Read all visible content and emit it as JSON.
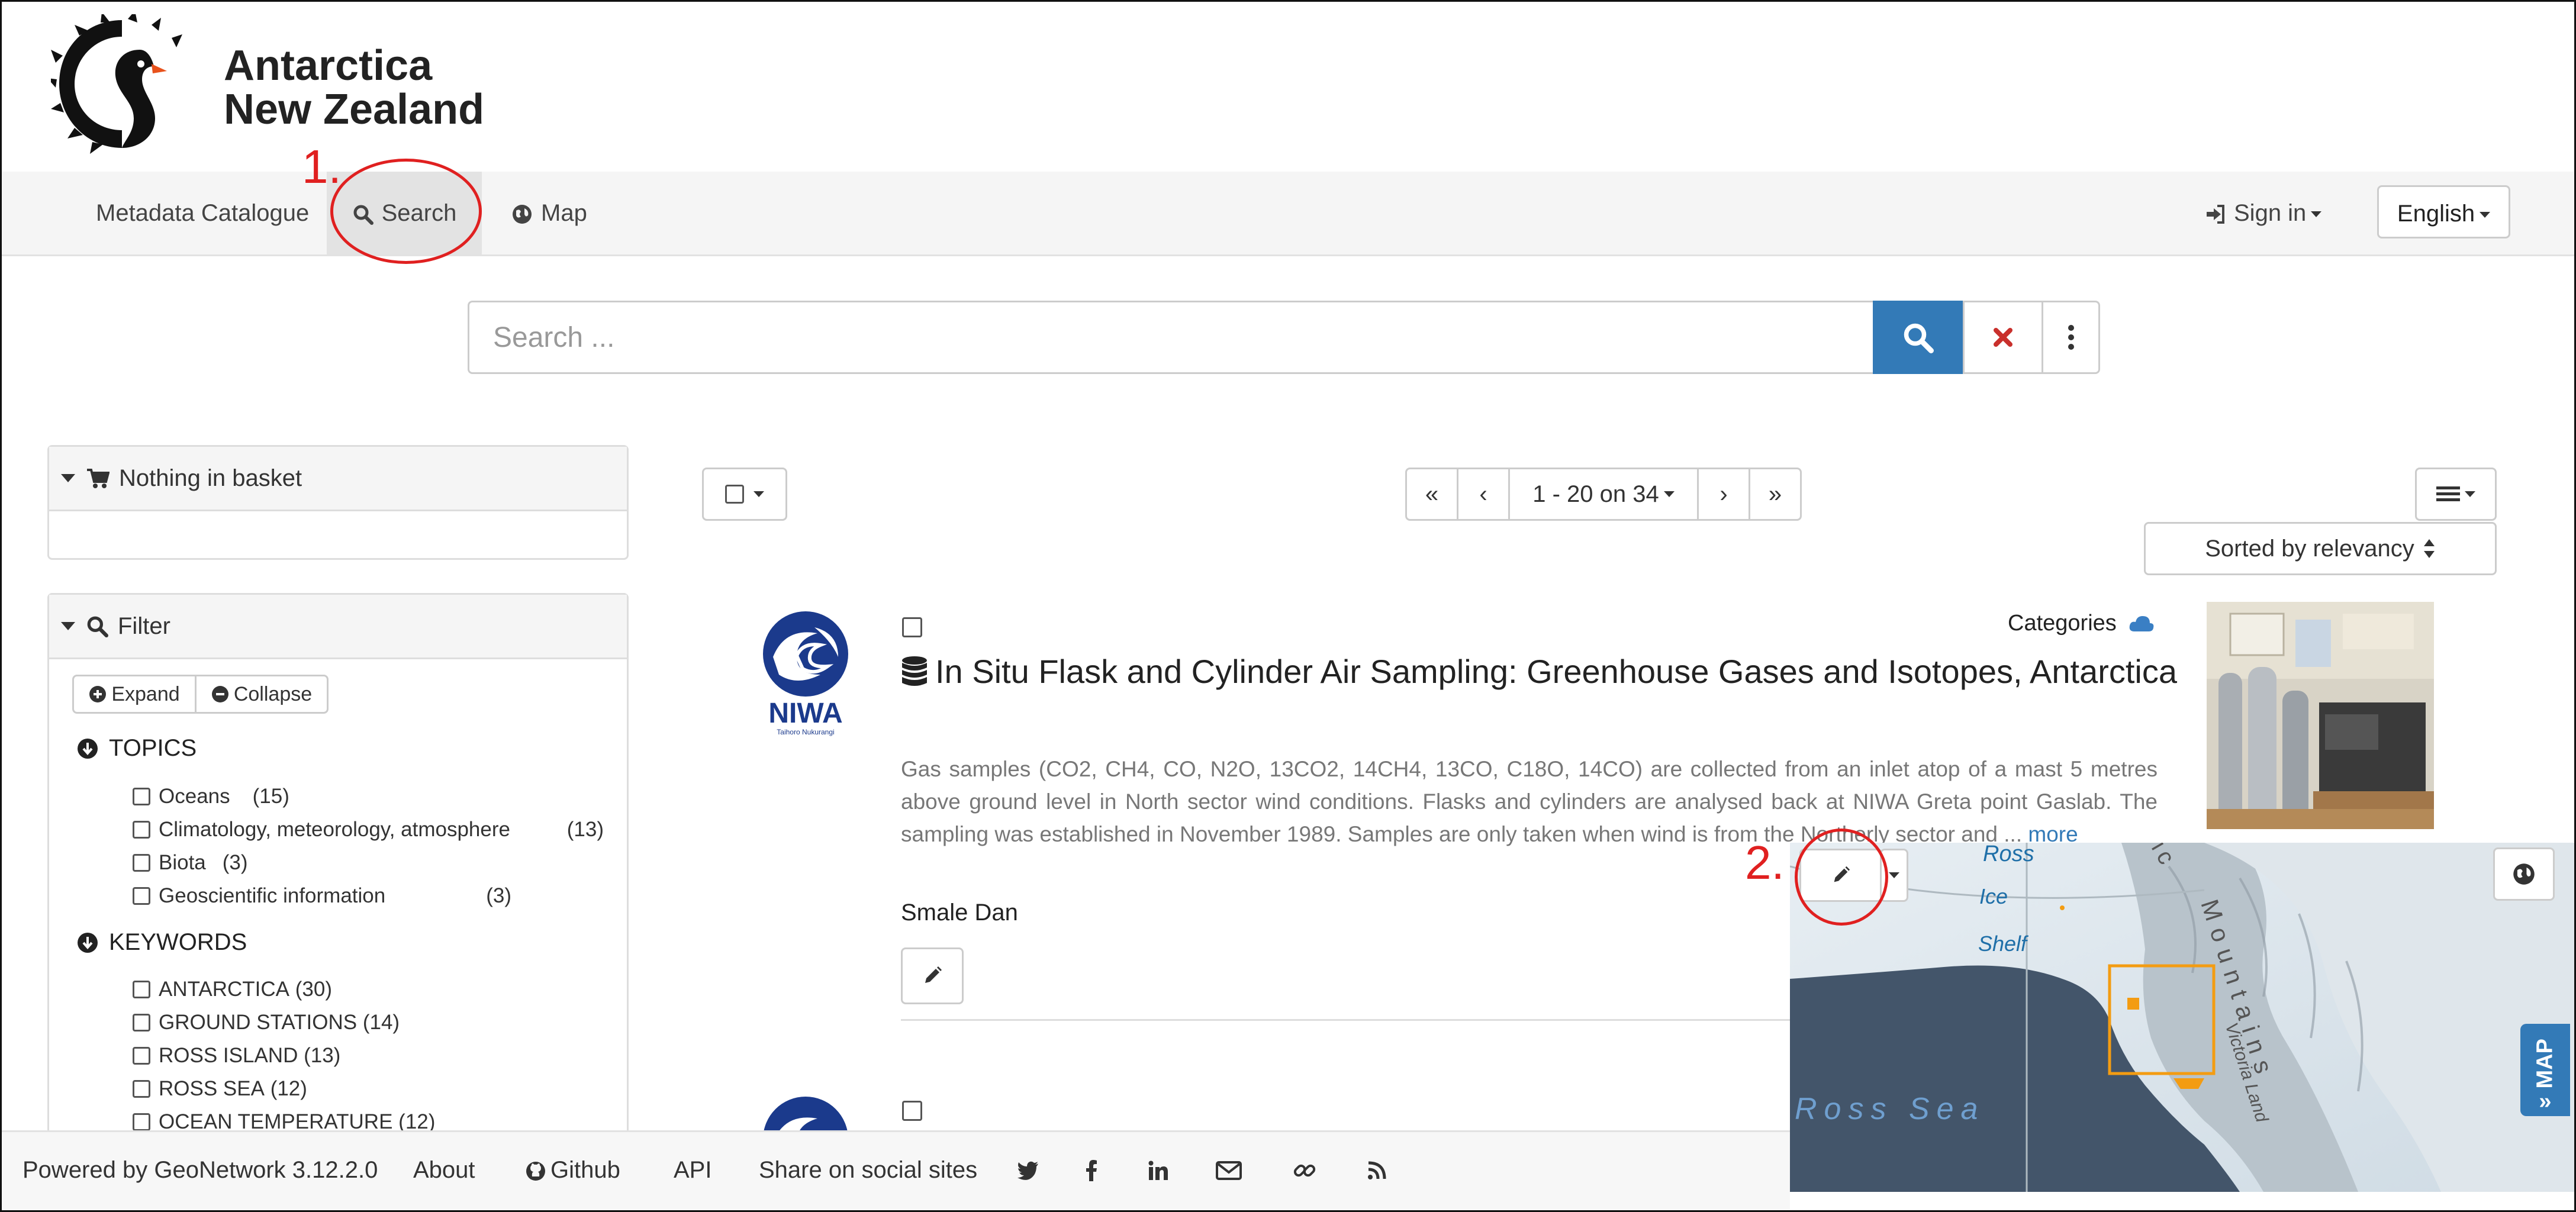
{
  "header": {
    "logo_line1": "Antarctica",
    "logo_line2": "New Zealand"
  },
  "nav": {
    "catalogue": "Metadata Catalogue",
    "search": "Search",
    "map": "Map",
    "sign_in": "Sign in",
    "language": "English"
  },
  "search": {
    "placeholder": "Search ..."
  },
  "basket": {
    "title": "Nothing in basket"
  },
  "filter": {
    "title": "Filter",
    "expand": "Expand",
    "collapse": "Collapse",
    "topics": {
      "title": "TOPICS",
      "items": [
        {
          "label": "Oceans",
          "count": "(15)"
        },
        {
          "label": "Climatology, meteorology, atmosphere",
          "count": "(13)"
        },
        {
          "label": "Biota",
          "count": "(3)"
        },
        {
          "label": "Geoscientific information",
          "count": "(3)"
        }
      ]
    },
    "keywords": {
      "title": "KEYWORDS",
      "items": [
        {
          "label": "ANTARCTICA",
          "count": "(30)"
        },
        {
          "label": "GROUND STATIONS",
          "count": "(14)"
        },
        {
          "label": "ROSS ISLAND",
          "count": "(13)"
        },
        {
          "label": "ROSS SEA",
          "count": "(12)"
        },
        {
          "label": "OCEAN TEMPERATURE",
          "count": "(12)"
        }
      ]
    }
  },
  "results": {
    "pager": "1 - 20 on 34",
    "sort": "Sorted by relevancy",
    "item": {
      "org_logo_text": "NIWA",
      "org_logo_sub": "Taihoro Nukurangi",
      "categories_label": "Categories",
      "title": "In Situ Flask and Cylinder Air Sampling: Greenhouse Gases and Isotopes, Antarctica",
      "abstract": "Gas samples (CO2, CH4, CO, N2O, 13CO2, 14CH4, 13CO, C18O, 14CO) are collected from an inlet atop of a mast 5 metres above ground level in North sector wind conditions. Flasks and cylinders are analysed back at NIWA Greta point Gaslab. The sampling was established in November 1989. Samples are only taken when wind is from the Northerly sector and ...",
      "more": "more",
      "owner": "Smale Dan"
    }
  },
  "map": {
    "labels": {
      "ross": "Ross",
      "ice": "Ice",
      "shelf": "Shelf",
      "ross_sea": "Ross Sea",
      "mountains": "Mountains",
      "victoria_land": "Victoria Land",
      "ic": "ic"
    },
    "tab": "MAP",
    "bbox_color": "#f39c12"
  },
  "footer": {
    "powered": "Powered by GeoNetwork 3.12.2.0",
    "about": "About",
    "github": "Github",
    "api": "API",
    "share": "Share on social sites"
  },
  "annotations": {
    "one": "1.",
    "two": "2."
  },
  "colors": {
    "primary": "#337ab7",
    "danger": "#c9302c",
    "annotation": "#e02020"
  }
}
